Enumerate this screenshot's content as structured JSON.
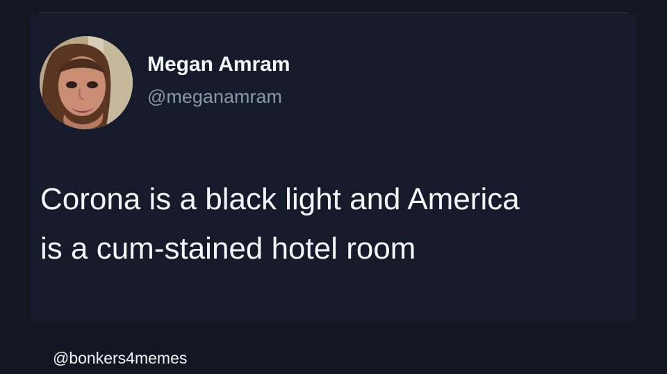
{
  "colors": {
    "page_background": "#131722",
    "card_background": "#151b2b",
    "primary_text": "#f4f6f8",
    "secondary_text": "#8a96a4",
    "divider": "#3a4150"
  },
  "tweet": {
    "avatar": {
      "icon": "profile-photo"
    },
    "author": {
      "display_name": "Megan Amram",
      "handle": "@meganamram"
    },
    "text_lines": [
      "Corona is a black light and America",
      "is a cum-stained hotel room"
    ]
  },
  "watermark": {
    "text": "@bonkers4memes"
  }
}
